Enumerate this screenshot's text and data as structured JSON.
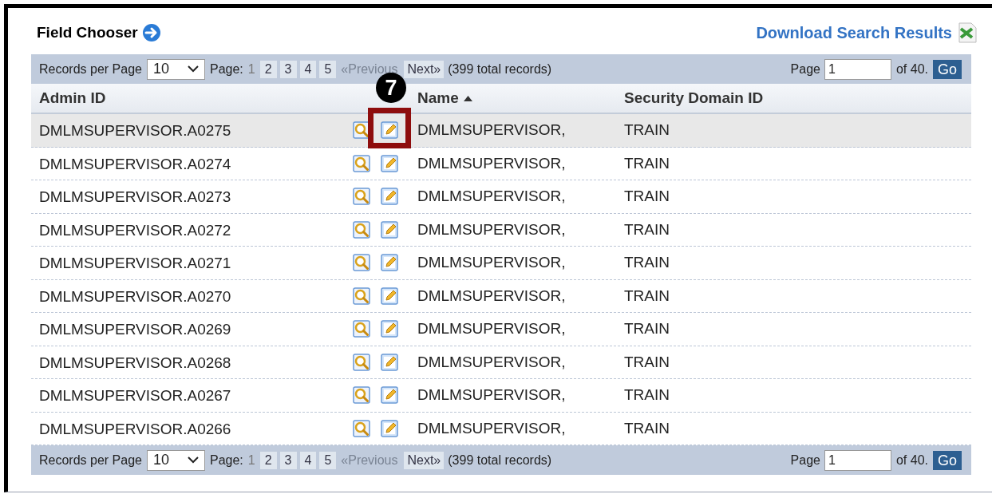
{
  "header": {
    "title": "Field Chooser",
    "download_link": "Download Search Results"
  },
  "pagers": [
    {
      "records_label": "Records per Page",
      "per_page": "10",
      "page_label": "Page:",
      "pages": [
        {
          "label": "1",
          "selected": true
        },
        {
          "label": "2",
          "selected": false
        },
        {
          "label": "3",
          "selected": false
        },
        {
          "label": "4",
          "selected": false
        },
        {
          "label": "5",
          "selected": false
        }
      ],
      "previous": {
        "label": "«Previous",
        "disabled": true
      },
      "next": {
        "label": "Next»",
        "disabled": false
      },
      "total": "(399 total records)",
      "goto_label": "Page",
      "goto_value": "1",
      "of_label": "of 40.",
      "go": "Go"
    },
    {
      "records_label": "Records per Page",
      "per_page": "10",
      "page_label": "Page:",
      "pages": [
        {
          "label": "1",
          "selected": true
        },
        {
          "label": "2",
          "selected": false
        },
        {
          "label": "3",
          "selected": false
        },
        {
          "label": "4",
          "selected": false
        },
        {
          "label": "5",
          "selected": false
        }
      ],
      "previous": {
        "label": "«Previous",
        "disabled": true
      },
      "next": {
        "label": "Next»",
        "disabled": false
      },
      "total": "(399 total records)",
      "goto_label": "Page",
      "goto_value": "1",
      "of_label": "of 40.",
      "go": "Go"
    }
  ],
  "table": {
    "columns": [
      {
        "label": "Admin ID"
      },
      {
        "label": "Name",
        "sorted": true
      },
      {
        "label": "Security Domain ID"
      }
    ],
    "rows": [
      {
        "admin_id": "DMLMSUPERVISOR.A0275",
        "name": "DMLMSUPERVISOR,",
        "domain": "TRAIN",
        "selected": true,
        "callout": "7"
      },
      {
        "admin_id": "DMLMSUPERVISOR.A0274",
        "name": "DMLMSUPERVISOR,",
        "domain": "TRAIN",
        "selected": false
      },
      {
        "admin_id": "DMLMSUPERVISOR.A0273",
        "name": "DMLMSUPERVISOR,",
        "domain": "TRAIN",
        "selected": false
      },
      {
        "admin_id": "DMLMSUPERVISOR.A0272",
        "name": "DMLMSUPERVISOR,",
        "domain": "TRAIN",
        "selected": false
      },
      {
        "admin_id": "DMLMSUPERVISOR.A0271",
        "name": "DMLMSUPERVISOR,",
        "domain": "TRAIN",
        "selected": false
      },
      {
        "admin_id": "DMLMSUPERVISOR.A0270",
        "name": "DMLMSUPERVISOR,",
        "domain": "TRAIN",
        "selected": false
      },
      {
        "admin_id": "DMLMSUPERVISOR.A0269",
        "name": "DMLMSUPERVISOR,",
        "domain": "TRAIN",
        "selected": false
      },
      {
        "admin_id": "DMLMSUPERVISOR.A0268",
        "name": "DMLMSUPERVISOR,",
        "domain": "TRAIN",
        "selected": false
      },
      {
        "admin_id": "DMLMSUPERVISOR.A0267",
        "name": "DMLMSUPERVISOR,",
        "domain": "TRAIN",
        "selected": false
      },
      {
        "admin_id": "DMLMSUPERVISOR.A0266",
        "name": "DMLMSUPERVISOR,",
        "domain": "TRAIN",
        "selected": false
      }
    ]
  }
}
